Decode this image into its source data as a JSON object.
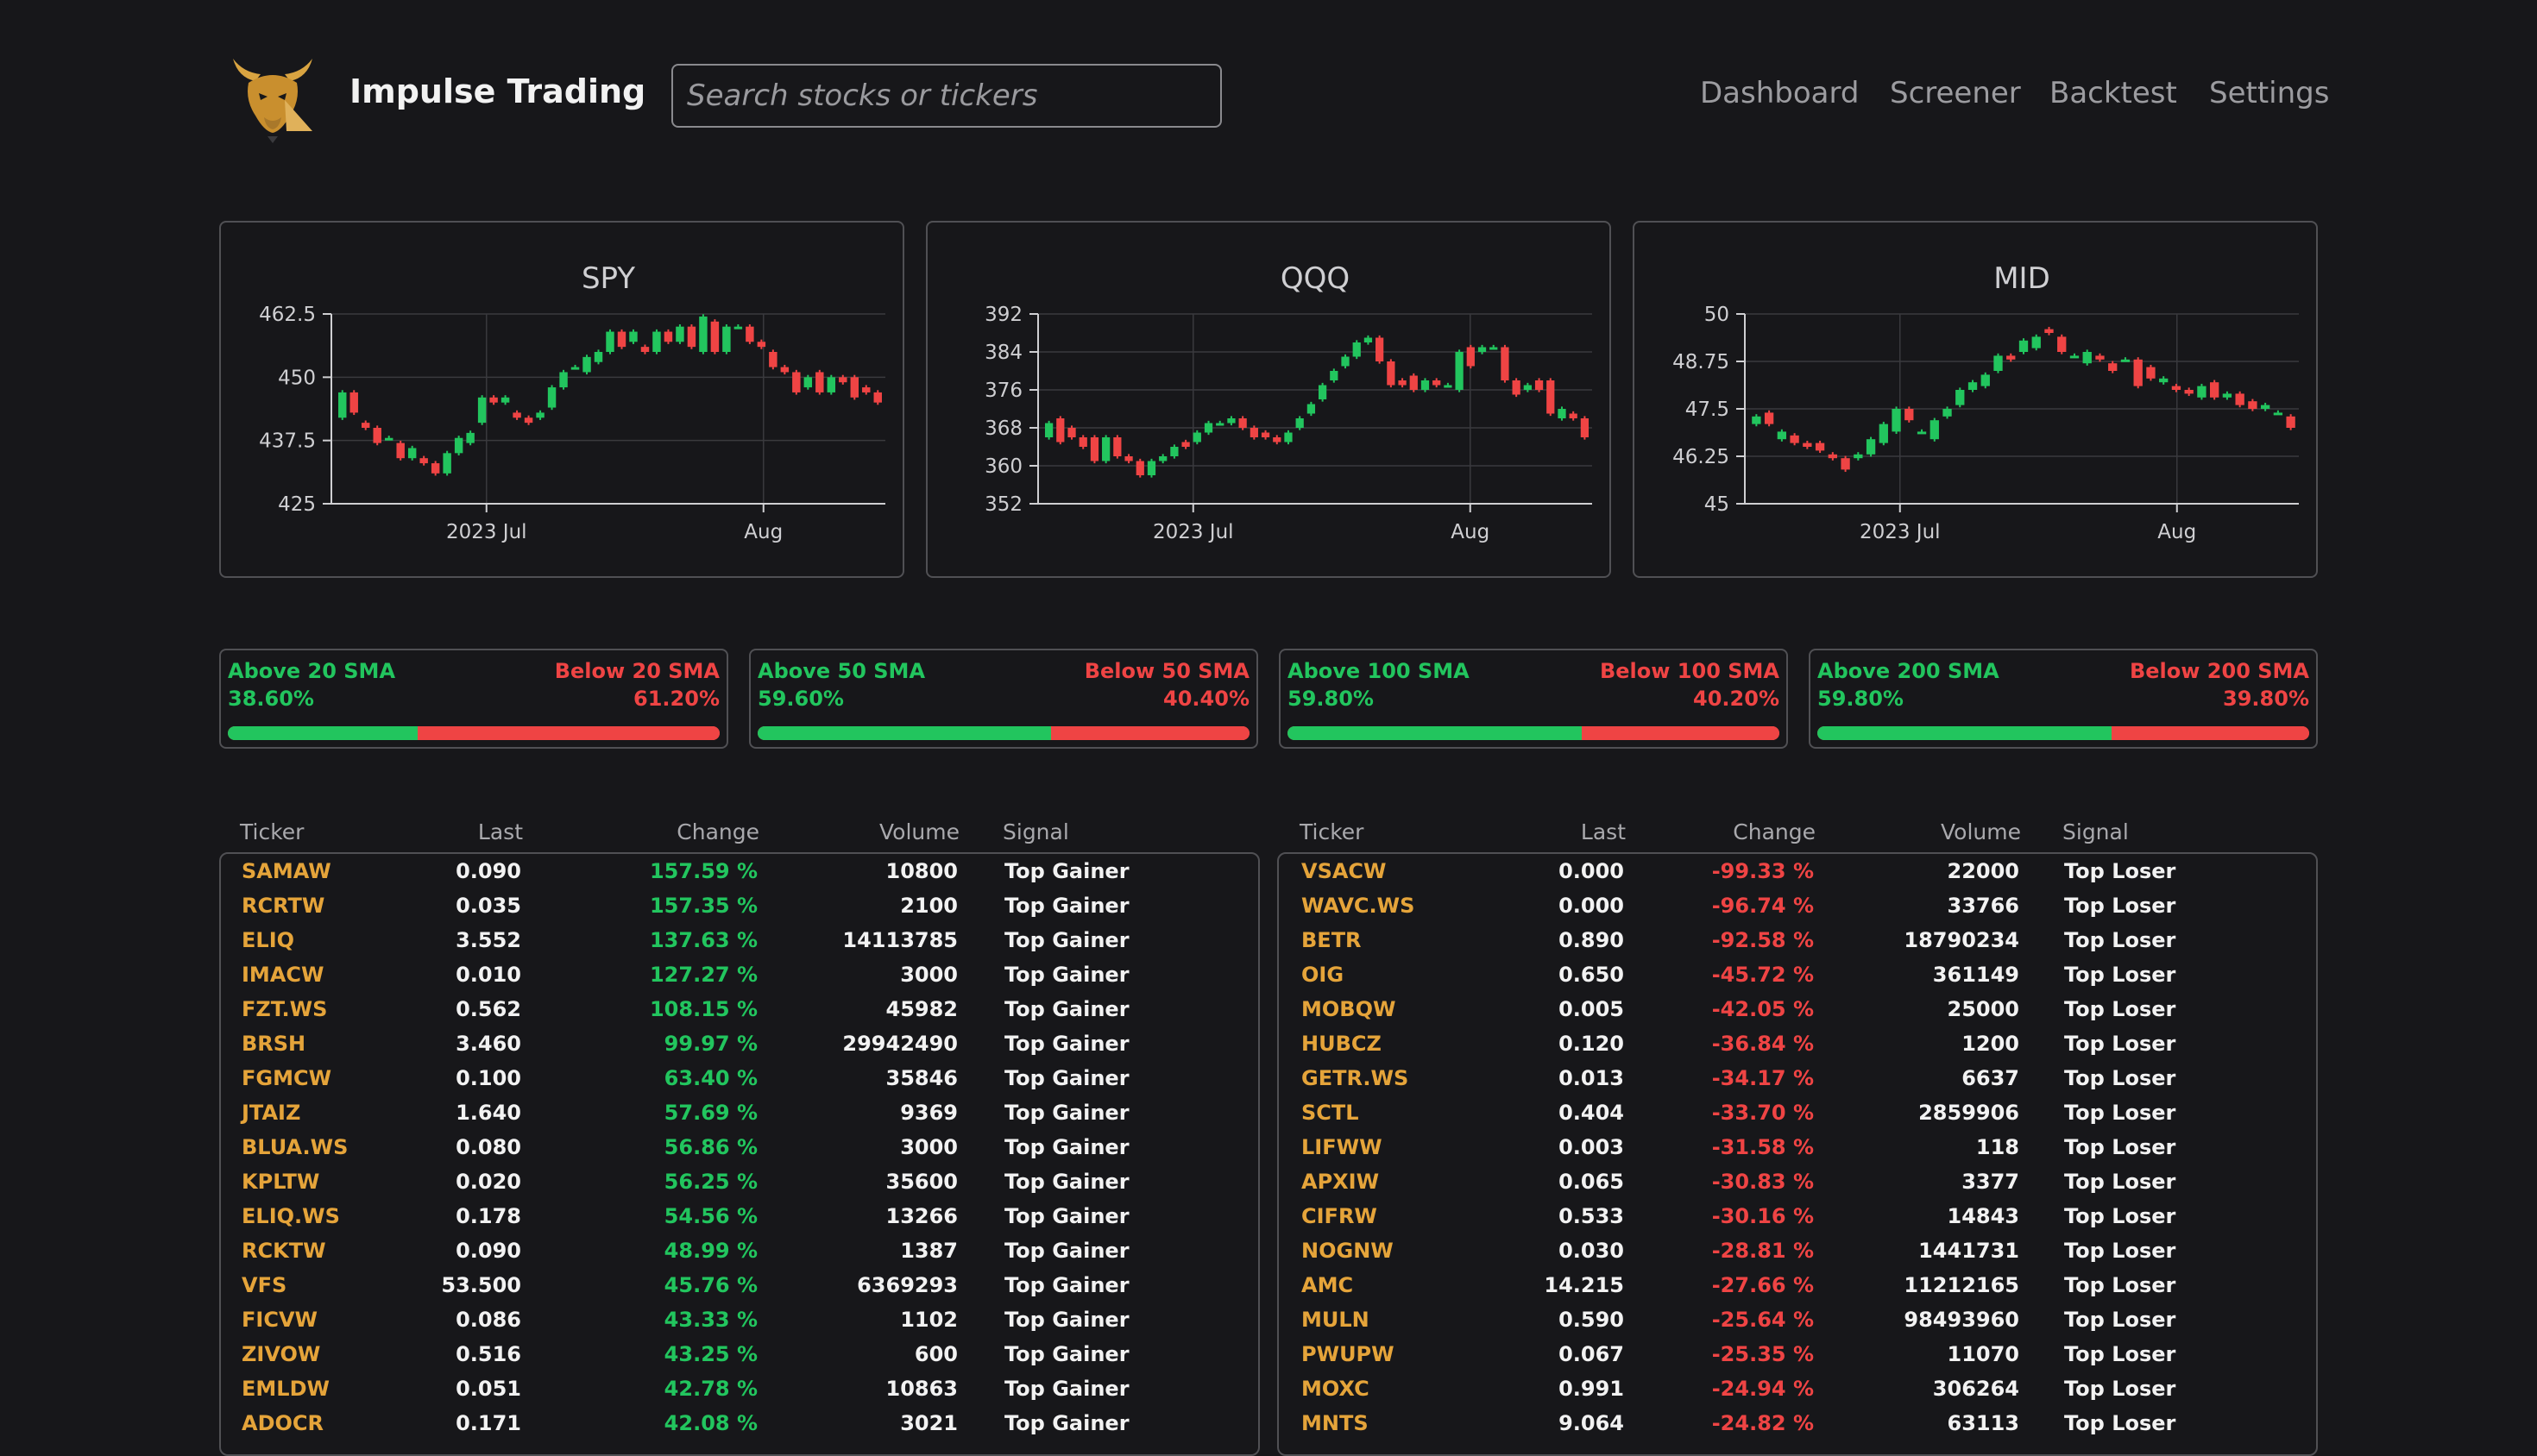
{
  "app": {
    "title": "Impulse Trading"
  },
  "search": {
    "placeholder": "Search stocks or tickers"
  },
  "nav": [
    "Dashboard",
    "Screener",
    "Backtest",
    "Settings"
  ],
  "colors": {
    "up": "#22c55e",
    "down": "#ef4444",
    "ticker": "#e5a43a",
    "background": "#17171a",
    "border": "#505054"
  },
  "icons": {
    "logo": "bull-head-icon"
  },
  "charts": [
    {
      "title": "SPY",
      "yticks": [
        "462.5",
        "450",
        "437.5",
        "425"
      ],
      "xticks": [
        "2023 Jul",
        "Aug"
      ],
      "chart_data": {
        "type": "candlestick",
        "y_range": [
          425,
          462.5
        ],
        "x_labels": [
          "2023 Jul",
          "Aug"
        ],
        "candles": [
          [
            442,
            447
          ],
          [
            447,
            443
          ],
          [
            441,
            440
          ],
          [
            440,
            437
          ],
          [
            438,
            438
          ],
          [
            437,
            434
          ],
          [
            434,
            436
          ],
          [
            434,
            433
          ],
          [
            433,
            431
          ],
          [
            431,
            435
          ],
          [
            435,
            438
          ],
          [
            437,
            439
          ],
          [
            441,
            446
          ],
          [
            446,
            445
          ],
          [
            445,
            446
          ],
          [
            443,
            442
          ],
          [
            442,
            441
          ],
          [
            442,
            443
          ],
          [
            444,
            448
          ],
          [
            448,
            451
          ],
          [
            452,
            452
          ],
          [
            451,
            454
          ],
          [
            453,
            455
          ],
          [
            455,
            459
          ],
          [
            459,
            456
          ],
          [
            457,
            459
          ],
          [
            456,
            455
          ],
          [
            455,
            459
          ],
          [
            459,
            457
          ],
          [
            457,
            460
          ],
          [
            460,
            456
          ],
          [
            455,
            462
          ],
          [
            461,
            455
          ],
          [
            455,
            460
          ],
          [
            460,
            460
          ],
          [
            460,
            457
          ],
          [
            457,
            456
          ],
          [
            455,
            452
          ],
          [
            452,
            451
          ],
          [
            451,
            447
          ],
          [
            448,
            450
          ],
          [
            451,
            447
          ],
          [
            447,
            450
          ],
          [
            450,
            449
          ],
          [
            450,
            446
          ],
          [
            448,
            447
          ],
          [
            447,
            445
          ]
        ]
      }
    },
    {
      "title": "QQQ",
      "yticks": [
        "392",
        "384",
        "376",
        "368",
        "360",
        "352"
      ],
      "xticks": [
        "2023 Jul",
        "Aug"
      ],
      "chart_data": {
        "type": "candlestick",
        "y_range": [
          352,
          392
        ],
        "x_labels": [
          "2023 Jul",
          "Aug"
        ],
        "candles": [
          [
            366,
            369
          ],
          [
            370,
            365
          ],
          [
            368,
            366
          ],
          [
            366,
            364
          ],
          [
            366,
            361
          ],
          [
            361,
            366
          ],
          [
            366,
            362
          ],
          [
            362,
            361
          ],
          [
            361,
            358
          ],
          [
            358,
            361
          ],
          [
            361,
            362
          ],
          [
            362,
            364
          ],
          [
            365,
            364
          ],
          [
            365,
            367
          ],
          [
            367,
            369
          ],
          [
            369,
            369
          ],
          [
            369,
            370
          ],
          [
            370,
            368
          ],
          [
            368,
            366
          ],
          [
            367,
            366
          ],
          [
            366,
            365
          ],
          [
            365,
            367
          ],
          [
            368,
            370
          ],
          [
            371,
            373
          ],
          [
            374,
            377
          ],
          [
            378,
            380
          ],
          [
            381,
            383
          ],
          [
            383,
            386
          ],
          [
            386,
            387
          ],
          [
            387,
            382
          ],
          [
            382,
            377
          ],
          [
            378,
            377
          ],
          [
            379,
            376
          ],
          [
            376,
            378
          ],
          [
            378,
            377
          ],
          [
            377,
            377
          ],
          [
            376,
            384
          ],
          [
            385,
            381
          ],
          [
            384,
            385
          ],
          [
            385,
            385
          ],
          [
            385,
            378
          ],
          [
            378,
            375
          ],
          [
            376,
            377
          ],
          [
            378,
            376
          ],
          [
            378,
            371
          ],
          [
            370,
            372
          ],
          [
            371,
            370
          ],
          [
            370,
            366
          ]
        ]
      }
    },
    {
      "title": "MID",
      "yticks": [
        "50",
        "48.75",
        "47.5",
        "46.25",
        "45"
      ],
      "xticks": [
        "2023 Jul",
        "Aug"
      ],
      "chart_data": {
        "type": "candlestick",
        "y_range": [
          45,
          50
        ],
        "x_labels": [
          "2023 Jul",
          "Aug"
        ],
        "candles": [
          [
            47.1,
            47.3
          ],
          [
            47.4,
            47.1
          ],
          [
            46.7,
            46.9
          ],
          [
            46.8,
            46.6
          ],
          [
            46.6,
            46.5
          ],
          [
            46.6,
            46.4
          ],
          [
            46.3,
            46.2
          ],
          [
            46.2,
            45.9
          ],
          [
            46.2,
            46.3
          ],
          [
            46.3,
            46.7
          ],
          [
            46.6,
            47.1
          ],
          [
            46.9,
            47.5
          ],
          [
            47.5,
            47.2
          ],
          [
            46.9,
            46.9
          ],
          [
            46.7,
            47.2
          ],
          [
            47.3,
            47.5
          ],
          [
            47.6,
            48.0
          ],
          [
            48.0,
            48.2
          ],
          [
            48.1,
            48.4
          ],
          [
            48.5,
            48.9
          ],
          [
            48.9,
            48.8
          ],
          [
            49.0,
            49.3
          ],
          [
            49.1,
            49.4
          ],
          [
            49.6,
            49.5
          ],
          [
            49.4,
            49.0
          ],
          [
            48.9,
            48.9
          ],
          [
            48.7,
            49.0
          ],
          [
            48.9,
            48.8
          ],
          [
            48.7,
            48.5
          ],
          [
            48.8,
            48.8
          ],
          [
            48.8,
            48.1
          ],
          [
            48.6,
            48.3
          ],
          [
            48.2,
            48.3
          ],
          [
            48.1,
            48.0
          ],
          [
            48.0,
            47.9
          ],
          [
            47.8,
            48.1
          ],
          [
            48.2,
            47.8
          ],
          [
            47.8,
            47.9
          ],
          [
            47.9,
            47.6
          ],
          [
            47.7,
            47.5
          ],
          [
            47.5,
            47.6
          ],
          [
            47.4,
            47.4
          ],
          [
            47.3,
            47.0
          ]
        ]
      }
    }
  ],
  "sma": [
    {
      "above_label": "Above 20 SMA",
      "below_label": "Below 20 SMA",
      "above_pct": "38.60%",
      "below_pct": "61.20%",
      "above_value": 38.6,
      "below_value": 61.2
    },
    {
      "above_label": "Above 50 SMA",
      "below_label": "Below 50 SMA",
      "above_pct": "59.60%",
      "below_pct": "40.40%",
      "above_value": 59.6,
      "below_value": 40.4
    },
    {
      "above_label": "Above 100 SMA",
      "below_label": "Below 100 SMA",
      "above_pct": "59.80%",
      "below_pct": "40.20%",
      "above_value": 59.8,
      "below_value": 40.2
    },
    {
      "above_label": "Above 200 SMA",
      "below_label": "Below 200 SMA",
      "above_pct": "59.80%",
      "below_pct": "39.80%",
      "above_value": 59.8,
      "below_value": 39.8
    }
  ],
  "tables": [
    {
      "headers": [
        "Ticker",
        "Last",
        "Change",
        "Volume",
        "Signal"
      ],
      "direction": "up",
      "rows": [
        [
          "SAMAW",
          "0.090",
          "157.59 %",
          "10800",
          "Top Gainer"
        ],
        [
          "RCRTW",
          "0.035",
          "157.35 %",
          "2100",
          "Top Gainer"
        ],
        [
          "ELIQ",
          "3.552",
          "137.63 %",
          "14113785",
          "Top Gainer"
        ],
        [
          "IMACW",
          "0.010",
          "127.27 %",
          "3000",
          "Top Gainer"
        ],
        [
          "FZT.WS",
          "0.562",
          "108.15 %",
          "45982",
          "Top Gainer"
        ],
        [
          "BRSH",
          "3.460",
          "99.97 %",
          "29942490",
          "Top Gainer"
        ],
        [
          "FGMCW",
          "0.100",
          "63.40 %",
          "35846",
          "Top Gainer"
        ],
        [
          "JTAIZ",
          "1.640",
          "57.69 %",
          "9369",
          "Top Gainer"
        ],
        [
          "BLUA.WS",
          "0.080",
          "56.86 %",
          "3000",
          "Top Gainer"
        ],
        [
          "KPLTW",
          "0.020",
          "56.25 %",
          "35600",
          "Top Gainer"
        ],
        [
          "ELIQ.WS",
          "0.178",
          "54.56 %",
          "13266",
          "Top Gainer"
        ],
        [
          "RCKTW",
          "0.090",
          "48.99 %",
          "1387",
          "Top Gainer"
        ],
        [
          "VFS",
          "53.500",
          "45.76 %",
          "6369293",
          "Top Gainer"
        ],
        [
          "FICVW",
          "0.086",
          "43.33 %",
          "1102",
          "Top Gainer"
        ],
        [
          "ZIVOW",
          "0.516",
          "43.25 %",
          "600",
          "Top Gainer"
        ],
        [
          "EMLDW",
          "0.051",
          "42.78 %",
          "10863",
          "Top Gainer"
        ],
        [
          "ADOCR",
          "0.171",
          "42.08 %",
          "3021",
          "Top Gainer"
        ]
      ]
    },
    {
      "headers": [
        "Ticker",
        "Last",
        "Change",
        "Volume",
        "Signal"
      ],
      "direction": "down",
      "rows": [
        [
          "VSACW",
          "0.000",
          "-99.33 %",
          "22000",
          "Top Loser"
        ],
        [
          "WAVC.WS",
          "0.000",
          "-96.74 %",
          "33766",
          "Top Loser"
        ],
        [
          "BETR",
          "0.890",
          "-92.58 %",
          "18790234",
          "Top Loser"
        ],
        [
          "OIG",
          "0.650",
          "-45.72 %",
          "361149",
          "Top Loser"
        ],
        [
          "MOBQW",
          "0.005",
          "-42.05 %",
          "25000",
          "Top Loser"
        ],
        [
          "HUBCZ",
          "0.120",
          "-36.84 %",
          "1200",
          "Top Loser"
        ],
        [
          "GETR.WS",
          "0.013",
          "-34.17 %",
          "6637",
          "Top Loser"
        ],
        [
          "SCTL",
          "0.404",
          "-33.70 %",
          "2859906",
          "Top Loser"
        ],
        [
          "LIFWW",
          "0.003",
          "-31.58 %",
          "118",
          "Top Loser"
        ],
        [
          "APXIW",
          "0.065",
          "-30.83 %",
          "3377",
          "Top Loser"
        ],
        [
          "CIFRW",
          "0.533",
          "-30.16 %",
          "14843",
          "Top Loser"
        ],
        [
          "NOGNW",
          "0.030",
          "-28.81 %",
          "1441731",
          "Top Loser"
        ],
        [
          "AMC",
          "14.215",
          "-27.66 %",
          "11212165",
          "Top Loser"
        ],
        [
          "MULN",
          "0.590",
          "-25.64 %",
          "98493960",
          "Top Loser"
        ],
        [
          "PWUPW",
          "0.067",
          "-25.35 %",
          "11070",
          "Top Loser"
        ],
        [
          "MOXC",
          "0.991",
          "-24.94 %",
          "306264",
          "Top Loser"
        ],
        [
          "MNTS",
          "9.064",
          "-24.82 %",
          "63113",
          "Top Loser"
        ]
      ]
    }
  ]
}
